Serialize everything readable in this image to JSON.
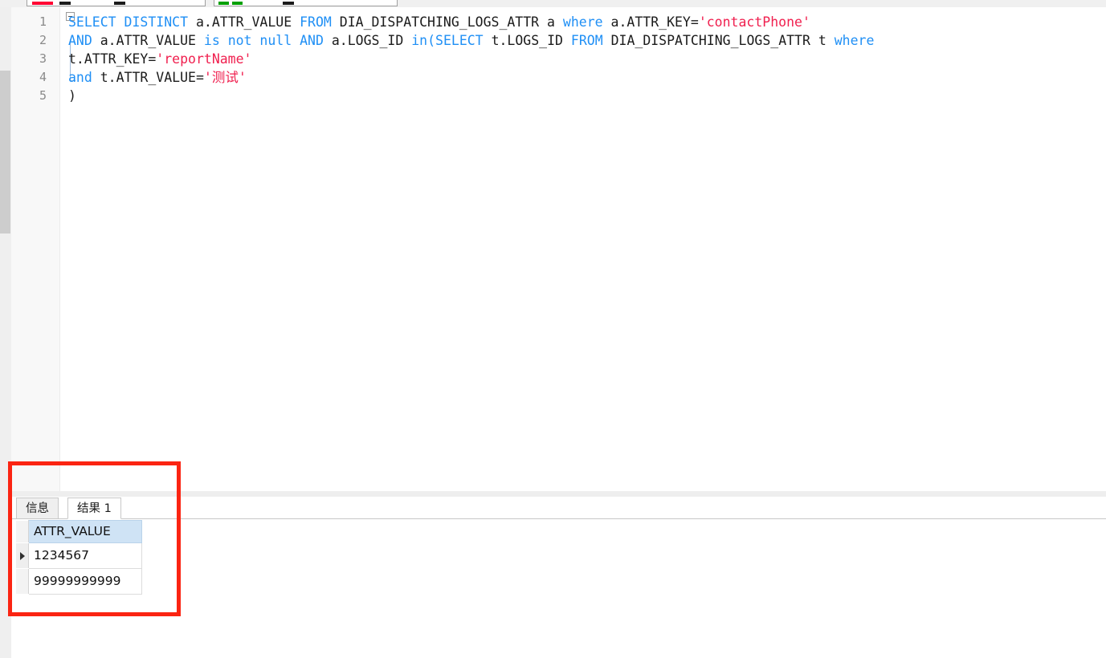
{
  "toolbar": {
    "box1_label": "",
    "box2_label": "",
    "swatch_red": "#ff0033",
    "swatch_green": "#00a000"
  },
  "editor": {
    "lines": [
      {
        "number": "1",
        "segments": [
          {
            "t": "SELECT DISTINCT ",
            "c": "kw"
          },
          {
            "t": "a.ATTR_VALUE ",
            "c": "pl"
          },
          {
            "t": "FROM ",
            "c": "kw"
          },
          {
            "t": "DIA_DISPATCHING_LOGS_ATTR a ",
            "c": "pl"
          },
          {
            "t": "where ",
            "c": "kw"
          },
          {
            "t": "a.ATTR_KEY=",
            "c": "pl"
          },
          {
            "t": "'contactPhone'",
            "c": "str"
          }
        ]
      },
      {
        "number": "2",
        "segments": [
          {
            "t": "AND ",
            "c": "kw"
          },
          {
            "t": "a.ATTR_VALUE ",
            "c": "pl"
          },
          {
            "t": "is not null ",
            "c": "kw"
          },
          {
            "t": "AND ",
            "c": "kw"
          },
          {
            "t": "a.LOGS_ID ",
            "c": "pl"
          },
          {
            "t": "in(",
            "c": "kw"
          },
          {
            "t": "SELECT ",
            "c": "kw"
          },
          {
            "t": "t.LOGS_ID ",
            "c": "pl"
          },
          {
            "t": "FROM ",
            "c": "kw"
          },
          {
            "t": "DIA_DISPATCHING_LOGS_ATTR t ",
            "c": "pl"
          },
          {
            "t": "where",
            "c": "kw"
          }
        ]
      },
      {
        "number": "3",
        "segments": [
          {
            "t": "t.ATTR_KEY=",
            "c": "pl"
          },
          {
            "t": "'reportName'",
            "c": "str"
          }
        ]
      },
      {
        "number": "4",
        "segments": [
          {
            "t": "and ",
            "c": "kw"
          },
          {
            "t": "t.ATTR_VALUE=",
            "c": "pl"
          },
          {
            "t": "'测试'",
            "c": "str"
          }
        ]
      },
      {
        "number": "5",
        "segments": [
          {
            "t": ")",
            "c": "pl"
          }
        ]
      }
    ],
    "colors": {
      "keyword": "#1f8ff5",
      "string": "#f0204f",
      "plain": "#1b1b1b",
      "linenumber": "#8a8a8a"
    }
  },
  "results_pane": {
    "tabs": [
      {
        "label": "信息",
        "active": false
      },
      {
        "label": "结果 1",
        "active": true
      }
    ],
    "grid": {
      "columns": [
        "ATTR_VALUE"
      ],
      "rows": [
        {
          "current": true,
          "cells": [
            "1234567"
          ]
        },
        {
          "current": false,
          "cells": [
            "99999999999"
          ]
        }
      ],
      "header_bg": "#cfe3f5"
    }
  },
  "annotation": {
    "highlight_color": "#fb2412"
  }
}
